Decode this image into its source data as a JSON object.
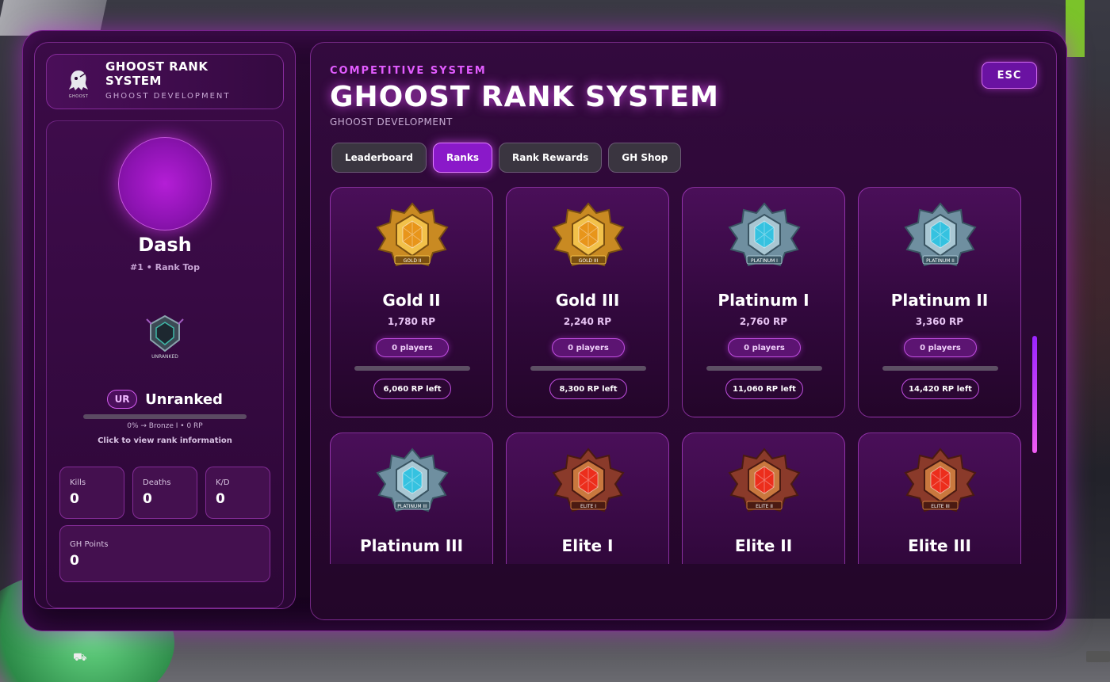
{
  "sidebar": {
    "brand_title": "GHOOST RANK SYSTEM",
    "brand_sub": "GHOOST DEVELOPMENT",
    "brand_logo_text": "GHOOST"
  },
  "profile": {
    "name": "Dash",
    "position": "#1 • Rank Top",
    "emblem_text": "UNRANKED",
    "rank_badge": "UR",
    "rank_name": "Unranked",
    "progress_percent": 0,
    "progress_text": "0% → Bronze I • 0 RP",
    "hint": "Click to view rank information",
    "stats": [
      {
        "label": "Kills",
        "value": "0"
      },
      {
        "label": "Deaths",
        "value": "0"
      },
      {
        "label": "K/D",
        "value": "0"
      }
    ],
    "points": {
      "label": "GH Points",
      "value": "0"
    }
  },
  "main": {
    "eyebrow": "COMPETITIVE SYSTEM",
    "title": "GHOOST RANK SYSTEM",
    "subtitle": "GHOOST DEVELOPMENT",
    "esc_label": "ESC",
    "tabs": [
      {
        "label": "Leaderboard",
        "active": false
      },
      {
        "label": "Ranks",
        "active": true
      },
      {
        "label": "Rank Rewards",
        "active": false
      },
      {
        "label": "GH Shop",
        "active": false
      }
    ]
  },
  "ranks": [
    {
      "name": "Gold II",
      "rp": "1,780 RP",
      "players": "0 players",
      "left": "6,060 RP left",
      "tier": "gold",
      "emblem_label": "GOLD II",
      "progress": 0
    },
    {
      "name": "Gold III",
      "rp": "2,240 RP",
      "players": "0 players",
      "left": "8,300 RP left",
      "tier": "gold",
      "emblem_label": "GOLD III",
      "progress": 0
    },
    {
      "name": "Platinum I",
      "rp": "2,760 RP",
      "players": "0 players",
      "left": "11,060 RP left",
      "tier": "platinum",
      "emblem_label": "PLATINUM I",
      "progress": 0
    },
    {
      "name": "Platinum II",
      "rp": "3,360 RP",
      "players": "0 players",
      "left": "14,420 RP left",
      "tier": "platinum",
      "emblem_label": "PLATINUM II",
      "progress": 0
    },
    {
      "name": "Platinum III",
      "rp": "",
      "players": "",
      "left": "",
      "tier": "platinum",
      "emblem_label": "PLATINUM III",
      "progress": 0
    },
    {
      "name": "Elite I",
      "rp": "",
      "players": "",
      "left": "",
      "tier": "elite",
      "emblem_label": "ELITE I",
      "progress": 0
    },
    {
      "name": "Elite II",
      "rp": "",
      "players": "",
      "left": "",
      "tier": "elite",
      "emblem_label": "ELITE II",
      "progress": 0
    },
    {
      "name": "Elite III",
      "rp": "",
      "players": "",
      "left": "",
      "tier": "elite",
      "emblem_label": "ELITE III",
      "progress": 0
    }
  ],
  "colors": {
    "accent": "#d44cf0",
    "gold": "#d9a336",
    "platinum": "#5fc8dc",
    "elite": "#e03a2a"
  },
  "scene": {
    "hint_key": "N"
  }
}
